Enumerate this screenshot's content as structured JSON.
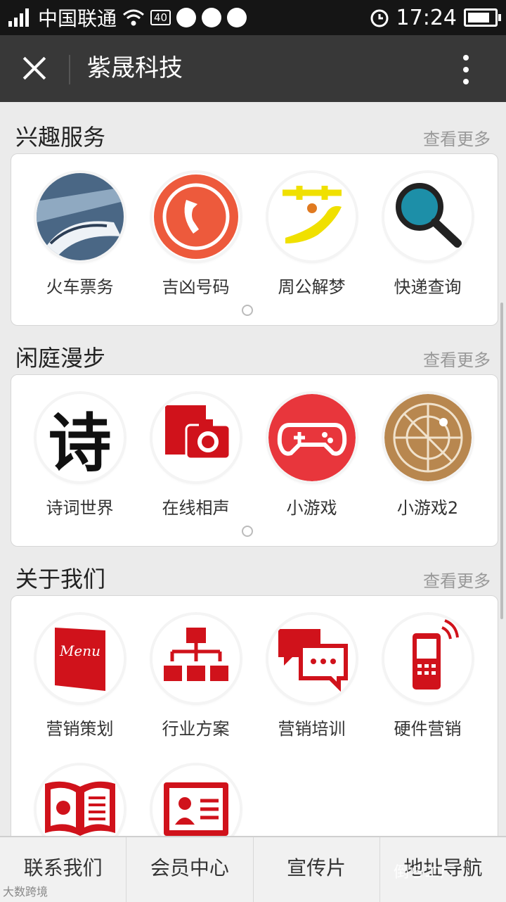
{
  "status": {
    "carrier": "中国联通",
    "network_badge": "40",
    "time": "17:24"
  },
  "header": {
    "title": "紫晟科技"
  },
  "sections": [
    {
      "title": "兴趣服务",
      "more": "查看更多",
      "items": [
        {
          "label": "火车票务",
          "icon": "train-icon"
        },
        {
          "label": "吉凶号码",
          "icon": "phone-icon"
        },
        {
          "label": "周公解梦",
          "icon": "dream-icon"
        },
        {
          "label": "快递查询",
          "icon": "magnifier-icon"
        }
      ]
    },
    {
      "title": "闲庭漫步",
      "more": "查看更多",
      "items": [
        {
          "label": "诗词世界",
          "icon": "poem-icon",
          "glyph": "诗"
        },
        {
          "label": "在线相声",
          "icon": "camera-icon"
        },
        {
          "label": "小游戏",
          "icon": "gamepad-icon"
        },
        {
          "label": "小游戏2",
          "icon": "radar-icon"
        }
      ]
    },
    {
      "title": "关于我们",
      "more": "查看更多",
      "items": [
        {
          "label": "营销策划",
          "icon": "menu-book-icon",
          "book_text": "Menu"
        },
        {
          "label": "行业方案",
          "icon": "org-chart-icon"
        },
        {
          "label": "营销培训",
          "icon": "chat-bubbles-icon"
        },
        {
          "label": "硬件营销",
          "icon": "mobile-phone-icon"
        },
        {
          "label": "",
          "icon": "open-book-icon"
        },
        {
          "label": "",
          "icon": "id-card-icon"
        }
      ]
    }
  ],
  "tabs": [
    "联系我们",
    "会员中心",
    "宣传片",
    "地址导航"
  ],
  "watermark": {
    "account": "倒らエ厂",
    "site": "大数跨境"
  },
  "colors": {
    "accent": "#d0121b",
    "titlebar": "#383838",
    "statusbar": "#151515"
  }
}
